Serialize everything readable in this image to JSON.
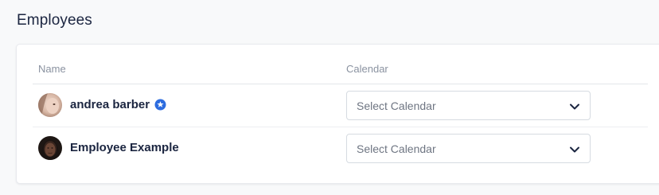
{
  "section": {
    "title": "Employees"
  },
  "table": {
    "columns": {
      "name": "Name",
      "calendar": "Calendar"
    },
    "rows": [
      {
        "name": "andrea barber",
        "badge_icon": "verified-star-icon",
        "avatar_icon": "avatar-photo",
        "calendar_placeholder": "Select Calendar"
      },
      {
        "name": "Employee Example",
        "avatar_icon": "avatar-photo",
        "calendar_placeholder": "Select Calendar"
      }
    ]
  },
  "colors": {
    "title": "#1b2540",
    "badge": "#2d6cdf",
    "muted": "#8a92a0",
    "border": "#d6dbe1"
  }
}
